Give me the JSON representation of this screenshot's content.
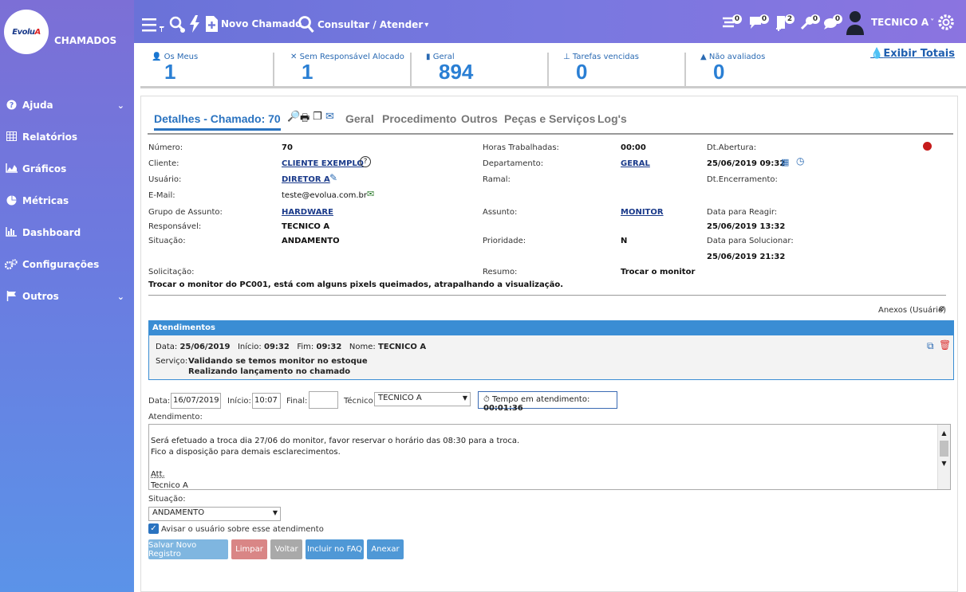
{
  "app": {
    "logo_text_a": "Evolu",
    "logo_text_b": "A",
    "title": "CHAMADOS"
  },
  "sidebar": {
    "items": [
      {
        "label": "Ajuda",
        "icon": "help-icon",
        "chevron": true
      },
      {
        "label": "Relatórios",
        "icon": "table-icon",
        "chevron": false
      },
      {
        "label": "Gráficos",
        "icon": "area-chart-icon",
        "chevron": false
      },
      {
        "label": "Métricas",
        "icon": "pie-chart-icon",
        "chevron": false
      },
      {
        "label": "Dashboard",
        "icon": "bar-chart-icon",
        "chevron": false
      },
      {
        "label": "Configurações",
        "icon": "gears-icon",
        "chevron": false
      },
      {
        "label": "Outros",
        "icon": "flag-icon",
        "chevron": true
      }
    ]
  },
  "toolbar": {
    "novo_chamado": "Novo Chamado",
    "consultar": "Consultar / Atender",
    "user": "TECNICO A",
    "badges": [
      "0",
      "0",
      "2",
      "0",
      "0"
    ]
  },
  "counters": [
    {
      "label": "Os Meus",
      "value": "1",
      "icon": "user-icon"
    },
    {
      "label": "Sem Responsável Alocado",
      "value": "1",
      "icon": "user-off-icon"
    },
    {
      "label": "Geral",
      "value": "894",
      "icon": "bookmark-icon"
    },
    {
      "label": "Tarefas vencidas",
      "value": "0",
      "icon": "pin-icon"
    },
    {
      "label": "Não avaliados",
      "value": "0",
      "icon": "warning-icon"
    }
  ],
  "exibir_totais": "Exibir Totais",
  "tabs": {
    "detalhes": "Detalhes - Chamado: 70",
    "geral": "Geral",
    "procedimento": "Procedimento",
    "outros": "Outros",
    "pecas": "Peças e Serviços",
    "logs": "Log's"
  },
  "details": {
    "numero_lbl": "Número:",
    "numero": "70",
    "cliente_lbl": "Cliente:",
    "cliente": "CLIENTE EXEMPLO",
    "usuario_lbl": "Usuário:",
    "usuario": "DIRETOR A",
    "email_lbl": "E-Mail:",
    "email": "teste@evolua.com.br",
    "grupo_lbl": "Grupo de Assunto:",
    "grupo": "HARDWARE",
    "responsavel_lbl": "Responsável:",
    "responsavel": "TECNICO A",
    "situacao_lbl": "Situação:",
    "situacao": "ANDAMENTO",
    "solicitacao_lbl": "Solicitação:",
    "solicitacao": "Trocar o monitor do PC001, está com alguns pixels queimados, atrapalhando a visualização.",
    "horas_lbl": "Horas Trabalhadas:",
    "horas": "00:00",
    "departamento_lbl": "Departamento:",
    "departamento": "GERAL",
    "ramal_lbl": "Ramal:",
    "assunto_lbl": "Assunto:",
    "assunto": "MONITOR",
    "prioridade_lbl": "Prioridade:",
    "prioridade": "N",
    "resumo_lbl": "Resumo:",
    "resumo": "Trocar o monitor",
    "abertura_lbl": "Dt.Abertura:",
    "abertura": "25/06/2019 09:32",
    "encerramento_lbl": "Dt.Encerramento:",
    "reagir_lbl": "Data para Reagir:",
    "reagir": "25/06/2019 13:32",
    "solucionar_lbl": "Data para Solucionar:",
    "solucionar": "25/06/2019 21:32",
    "anexos": "Anexos (Usuário)"
  },
  "atendimentos": {
    "title": "Atendimentos",
    "data_lbl": "Data:",
    "data": "25/06/2019",
    "inicio_lbl": "Início:",
    "inicio": "09:32",
    "fim_lbl": "Fim:",
    "fim": "09:32",
    "nome_lbl": "Nome:",
    "nome": "TECNICO A",
    "servico_lbl": "Serviço:",
    "servico1": "Validando se temos monitor no estoque",
    "servico2": "Realizando lançamento no chamado"
  },
  "form": {
    "data_lbl": "Data:",
    "data": "16/07/2019",
    "inicio_lbl": "Início:",
    "inicio": "10:07",
    "final_lbl": "Final:",
    "final": "",
    "tecnico_lbl": "Técnico:",
    "tecnico": "TECNICO A",
    "tempo_lbl": "Tempo em atendimento:",
    "tempo": "00:01:36",
    "atendimento_lbl": "Atendimento:",
    "text_lines": [
      "Será efetuado a troca dia 27/06 do monitor, favor reservar o horário das 08:30 para a troca.",
      "Fico a disposição para demais esclarecimentos.",
      "",
      "Att.",
      "Tecnico A"
    ],
    "situacao_lbl": "Situação:",
    "situacao": "ANDAMENTO",
    "avisar": "Avisar o usuário sobre esse atendimento"
  },
  "buttons": {
    "salvar": "Salvar Novo Registro",
    "limpar": "Limpar",
    "voltar": "Voltar",
    "faq": "Incluir no FAQ",
    "anexar": "Anexar"
  },
  "colors": {
    "sidebar_top": "#7c6fd6",
    "sidebar_bottom": "#5b93e8",
    "accent": "#2a73c0",
    "salvar": "#7fb6e0",
    "limpar": "#d98686",
    "voltar": "#a9a9a9",
    "faq": "#4f98d6",
    "anexar": "#4f98d6"
  }
}
